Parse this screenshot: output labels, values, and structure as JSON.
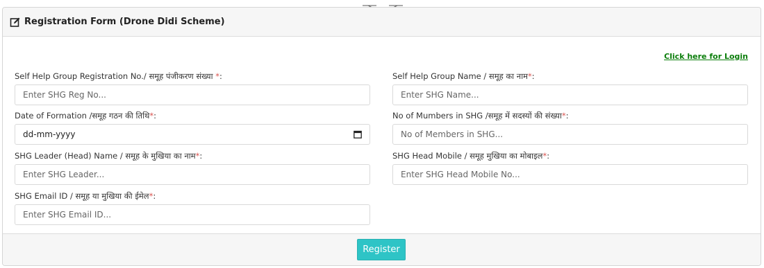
{
  "form": {
    "title": "Registration Form (Drone Didi Scheme)",
    "login_link": "Click here for Login",
    "fields": {
      "shg_reg_no": {
        "label": "Self Help Group Registration No./ समूह पंजीकरण संख्या ",
        "required": "*",
        "label_suffix": ":",
        "placeholder": "Enter SHG Reg No..."
      },
      "shg_name": {
        "label": "Self Help Group Name / समूह का नाम",
        "required": "*",
        "label_suffix": ":",
        "placeholder": "Enter SHG Name..."
      },
      "date_formation": {
        "label": "Date of Formation /समूह गठन की तिथि",
        "required": "*",
        "label_suffix": ":",
        "value": "dd-mm-yyyy"
      },
      "num_members": {
        "label": "No of Mumbers in SHG /समूह में सदस्यों की संख्या",
        "required": "*",
        "label_suffix": ":",
        "placeholder": "No of Members in SHG..."
      },
      "leader_name": {
        "label": "SHG Leader (Head) Name / समूह के मुखिया का नाम",
        "required": "*",
        "label_suffix": ":",
        "placeholder": "Enter SHG Leader..."
      },
      "head_mobile": {
        "label": "SHG Head Mobile / समूह मुखिया का मोबाइल",
        "required": "*",
        "label_suffix": ":",
        "placeholder": "Enter SHG Head Mobile No..."
      },
      "email": {
        "label": "SHG Email ID / समूह या मुखिया की ईमेल",
        "required": "*",
        "label_suffix": ":",
        "placeholder": "Enter SHG Email ID..."
      }
    },
    "register_label": "Register"
  },
  "colors": {
    "accent": "#2ec4c6",
    "link": "#0a7d0a",
    "required": "#d9534f"
  }
}
